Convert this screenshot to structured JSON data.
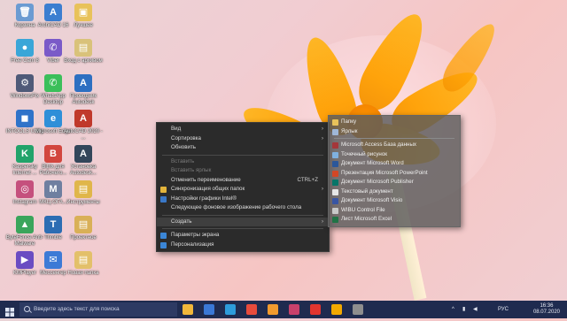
{
  "desktop": {
    "icons": [
      {
        "label": "Корзина",
        "color": "#6b9bd2",
        "glyph": "🗑"
      },
      {
        "label": "ArchiCAD 16",
        "color": "#3b7ed0",
        "glyph": "A"
      },
      {
        "label": "Лучшее",
        "color": "#e8c25a",
        "glyph": "▣"
      },
      {
        "label": "Free Cam 8",
        "color": "#3aa6d8",
        "glyph": "●"
      },
      {
        "label": "Viber",
        "color": "#7a5ac8",
        "glyph": "✆"
      },
      {
        "label": "Вход с архивом",
        "color": "#d9c27a",
        "glyph": "▤"
      },
      {
        "label": "WindowsFix",
        "color": "#4f5a78",
        "glyph": "⚙"
      },
      {
        "label": "WhatsApp Desktop",
        "color": "#3bbf5a",
        "glyph": "✆"
      },
      {
        "label": "Проводник Autodesk",
        "color": "#2d6fc1",
        "glyph": "A"
      },
      {
        "label": "INTOOLS Utility",
        "color": "#2f73c9",
        "glyph": "◼"
      },
      {
        "label": "Microsoft Edge",
        "color": "#2f8fd8",
        "glyph": "e"
      },
      {
        "label": "AutoCAD 2020 - ...",
        "color": "#c0392b",
        "glyph": "A"
      },
      {
        "label": "Kaspersky Internet ...",
        "color": "#22a36a",
        "glyph": "K"
      },
      {
        "label": "Bitrix для Рабочего...",
        "color": "#d2463e",
        "glyph": "B"
      },
      {
        "label": "Установка Autodesk...",
        "color": "#33465a",
        "glyph": "A"
      },
      {
        "label": "Instagram",
        "color": "#c5507d",
        "glyph": "◎"
      },
      {
        "label": "МКЦ-ОГА...",
        "color": "#6f7fa0",
        "glyph": "M"
      },
      {
        "label": "Инструменты",
        "color": "#e0b64a",
        "glyph": "▤"
      },
      {
        "label": "ByteFence Anti-Malware",
        "color": "#3aa55b",
        "glyph": "▲"
      },
      {
        "label": "Trimble",
        "color": "#2c6db3",
        "glyph": "T"
      },
      {
        "label": "Проектное",
        "color": "#d9b057",
        "glyph": "▤"
      },
      {
        "label": "KMPlayer",
        "color": "#6a4cc2",
        "glyph": "▶"
      },
      {
        "label": "Мессенгер",
        "color": "#3d7ad6",
        "glyph": "✉"
      },
      {
        "label": "Новая папка",
        "color": "#e3c06a",
        "glyph": "▤"
      }
    ]
  },
  "context_menu": {
    "items": [
      {
        "label": "Вид",
        "type": "submenu",
        "disabled": false
      },
      {
        "label": "Сортировка",
        "type": "submenu",
        "disabled": false
      },
      {
        "label": "Обновить",
        "type": "item",
        "disabled": false
      },
      {
        "type": "sep"
      },
      {
        "label": "Вставить",
        "type": "item",
        "disabled": true
      },
      {
        "label": "Вставить ярлык",
        "type": "item",
        "disabled": true
      },
      {
        "label": "Отменить переименование",
        "type": "item",
        "disabled": false,
        "shortcut": "CTRL+Z"
      },
      {
        "label": "Синхронизация общих папок",
        "type": "submenu",
        "disabled": false,
        "icon": "#e3b43b"
      },
      {
        "label": "Настройки графики Intel®",
        "type": "item",
        "disabled": false,
        "icon": "#3a78c8"
      },
      {
        "label": "Следующее фоновое изображение рабочего стола",
        "type": "item",
        "disabled": false
      },
      {
        "type": "sep"
      },
      {
        "label": "Создать",
        "type": "submenu",
        "disabled": false,
        "hover": true
      },
      {
        "type": "sep"
      },
      {
        "label": "Параметры экрана",
        "type": "item",
        "disabled": false,
        "icon": "#3b86d6"
      },
      {
        "label": "Персонализация",
        "type": "item",
        "disabled": false,
        "icon": "#3b86d6"
      }
    ]
  },
  "create_submenu": {
    "items": [
      {
        "label": "Папку",
        "icon": "#e8c25a"
      },
      {
        "label": "Ярлык",
        "icon": "#9fb7d8"
      },
      {
        "type": "sep"
      },
      {
        "label": "Microsoft Access База данных",
        "icon": "#a4373a"
      },
      {
        "label": "Точечный рисунок",
        "icon": "#7fb0e0"
      },
      {
        "label": "Документ Microsoft Word",
        "icon": "#2b579a"
      },
      {
        "label": "Презентация Microsoft PowerPoint",
        "icon": "#d24726"
      },
      {
        "label": "Документ Microsoft Publisher",
        "icon": "#077568"
      },
      {
        "label": "Текстовый документ",
        "icon": "#e6e6e6"
      },
      {
        "label": "Документ Microsoft Visio",
        "icon": "#3955a3"
      },
      {
        "label": "WIBU Control File",
        "icon": "#c8c8c8"
      },
      {
        "label": "Лист Microsoft Excel",
        "icon": "#217346"
      }
    ]
  },
  "taskbar": {
    "search_placeholder": "Введите здесь текст для поиска",
    "apps": [
      "#f0b73a",
      "#3a78d6",
      "#2d9cdb",
      "#e84b3c",
      "#f29b2e",
      "#c9416b",
      "#e3352f",
      "#f2a900",
      "#8e8e8e"
    ],
    "tray": {
      "lang": "РУС",
      "time": "16:36",
      "date": "08.07.2020"
    }
  }
}
